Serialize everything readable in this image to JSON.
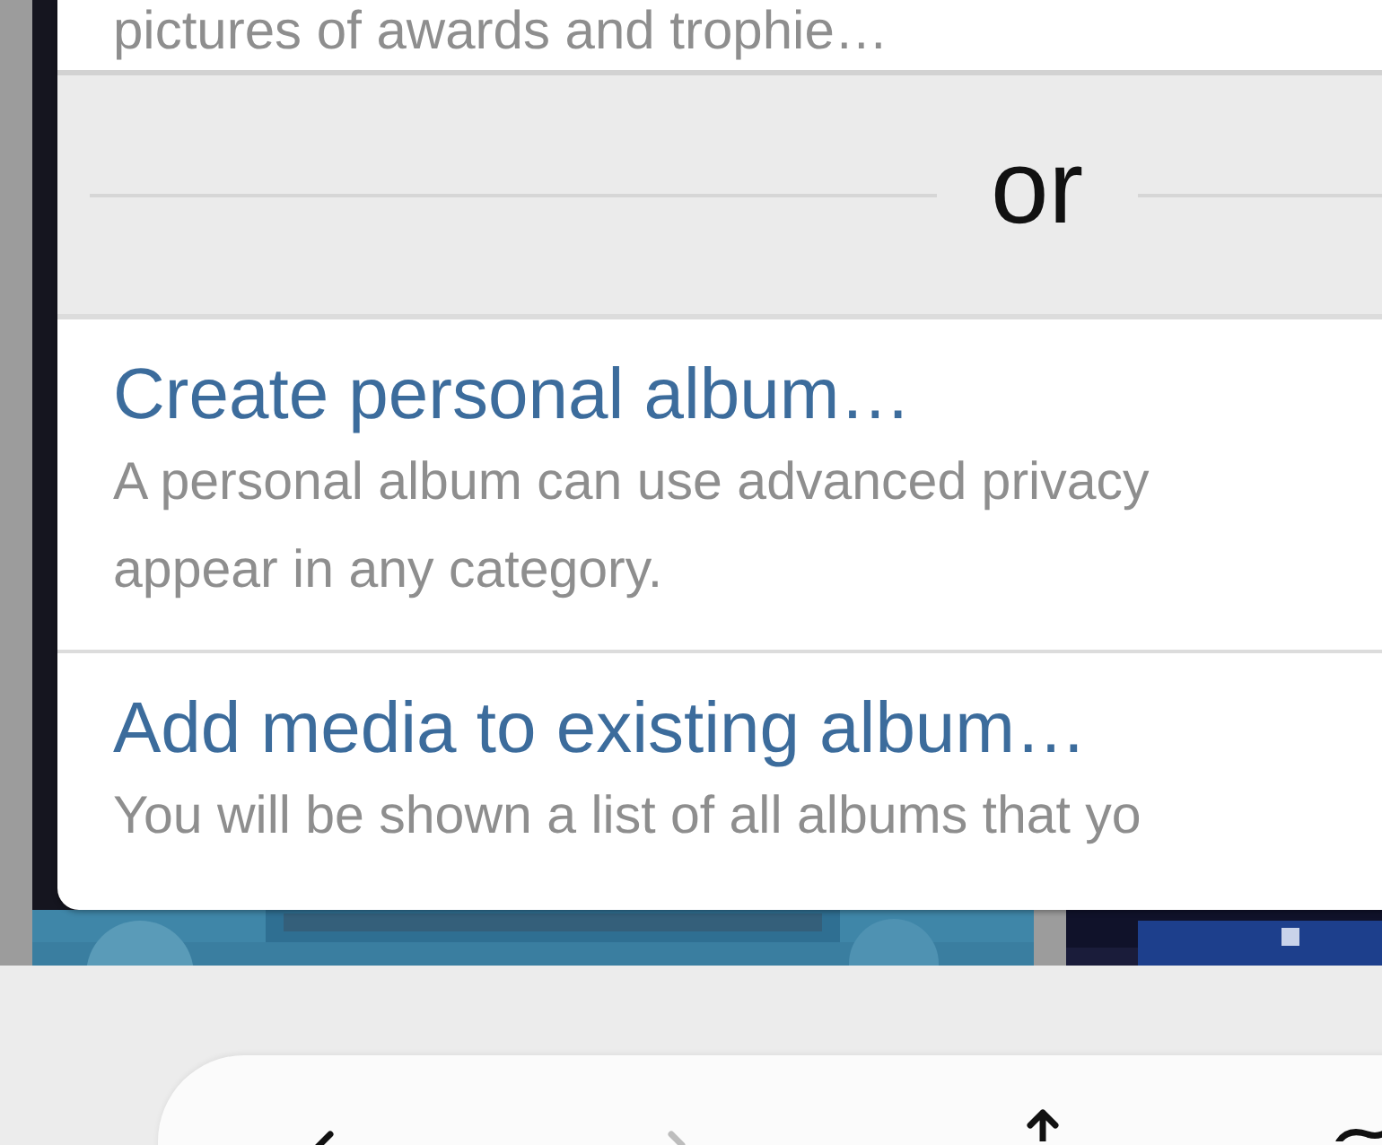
{
  "dialog": {
    "top_hint": "pictures of awards and trophie…",
    "separator": "or",
    "options": [
      {
        "title": "Create personal album…",
        "description": [
          "A personal album can use advanced privacy",
          "appear in any category."
        ]
      },
      {
        "title": "Add media to existing album…",
        "description": [
          "You will be shown a list of all albums that yo"
        ]
      }
    ]
  },
  "toolbar": {
    "buttons": [
      {
        "kind": "back",
        "disabled": false
      },
      {
        "kind": "forward",
        "disabled": true
      },
      {
        "kind": "share",
        "disabled": false
      },
      {
        "kind": "bookmarks",
        "disabled": false
      }
    ]
  }
}
